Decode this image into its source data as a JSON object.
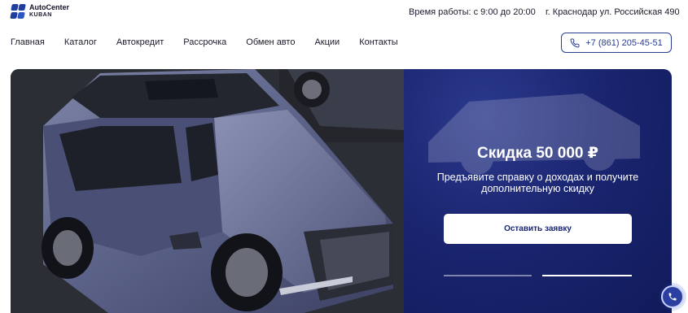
{
  "header": {
    "logo": {
      "line1": "AutoCenter",
      "line2": "KUBAN",
      "icon": "autocenter-logo-icon"
    },
    "hours": "Время работы: с 9:00 до 20:00",
    "address": "г. Краснодар ул. Российская 490"
  },
  "nav": {
    "items": [
      {
        "label": "Главная"
      },
      {
        "label": "Каталог"
      },
      {
        "label": "Автокредит"
      },
      {
        "label": "Рассрочка"
      },
      {
        "label": "Обмен авто"
      },
      {
        "label": "Акции"
      },
      {
        "label": "Контакты"
      }
    ],
    "phone": {
      "label": "+7 (861) 205-45-51",
      "icon": "phone-icon"
    }
  },
  "hero": {
    "image": "car-photo",
    "title": "Скидка 50 000 ₽",
    "description": "Предъявите справку о доходах и получите дополнительную скидку",
    "cta_label": "Оставить заявку",
    "slides": {
      "count": 2,
      "active": 2
    }
  },
  "floating": {
    "icon": "phone-icon"
  },
  "colors": {
    "brand": "#2a3d8f",
    "promo_bg": "#1a2570",
    "text": "#1b1b2b"
  }
}
